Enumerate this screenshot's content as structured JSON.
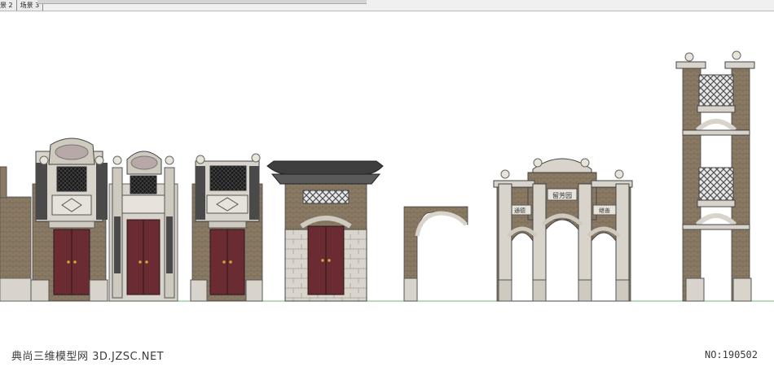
{
  "tabs": [
    {
      "label": "景 2",
      "active": false
    },
    {
      "label": "场景 3",
      "active": false
    }
  ],
  "plaques": {
    "arch_center": "留芳园",
    "arch_left": "通德",
    "arch_right": "继善"
  },
  "watermark": {
    "site": "典尚三维模型网 3D.JZSC.NET",
    "number": "NO:190502"
  },
  "colors": {
    "brick": "#8a7a64",
    "stone": "#d8d4cc",
    "door": "#6b2b33",
    "roof": "#3e3e3e",
    "ground": "#6dbb6d"
  }
}
